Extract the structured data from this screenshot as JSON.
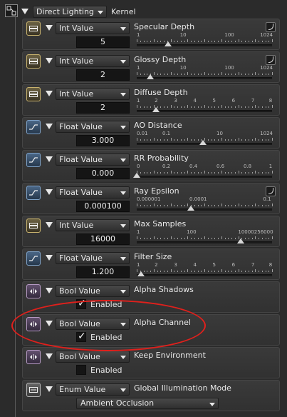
{
  "header": {
    "mode": "Direct Lighting",
    "kernel_label": "Kernel"
  },
  "params": [
    {
      "kind": "int",
      "vtype": "Int Value",
      "name": "Specular Depth",
      "value": "5",
      "curve": true,
      "ticks": [
        "1",
        "10",
        "100",
        "1024"
      ],
      "tick_pos": [
        0,
        0.33,
        0.66,
        1
      ],
      "thumb": 0.23
    },
    {
      "kind": "int",
      "vtype": "Int Value",
      "name": "Glossy Depth",
      "value": "2",
      "curve": true,
      "ticks": [
        "1",
        "10",
        "100",
        "1024"
      ],
      "tick_pos": [
        0,
        0.33,
        0.66,
        1
      ],
      "thumb": 0.1
    },
    {
      "kind": "int",
      "vtype": "Int Value",
      "name": "Diffuse Depth",
      "value": "2",
      "curve": false,
      "ticks": [
        "1",
        "2",
        "3",
        "4",
        "5",
        "6",
        "7",
        "8"
      ],
      "tick_pos": [
        0,
        0.143,
        0.286,
        0.429,
        0.571,
        0.714,
        0.857,
        1
      ],
      "thumb": 0.143
    },
    {
      "kind": "float",
      "vtype": "Float Value",
      "name": "AO Distance",
      "value": "3.000",
      "curve": false,
      "ticks": [
        "0.01",
        "0.1",
        "10",
        "1024"
      ],
      "tick_pos": [
        0,
        0.2,
        0.6,
        1
      ],
      "thumb": 0.49
    },
    {
      "kind": "float",
      "vtype": "Float Value",
      "name": "RR Probability",
      "value": "0.000",
      "curve": false,
      "ticks": [
        "0",
        "0.2",
        "0.4",
        "0.6",
        "0.8",
        "1"
      ],
      "tick_pos": [
        0,
        0.2,
        0.4,
        0.6,
        0.8,
        1
      ],
      "thumb": 0
    },
    {
      "kind": "float",
      "vtype": "Float Value",
      "name": "Ray Epsilon",
      "value": "0.000100",
      "curve": true,
      "ticks": [
        "0.000001",
        "0.0001",
        "0.1"
      ],
      "tick_pos": [
        0,
        0.4,
        1
      ],
      "thumb": 0.4
    },
    {
      "kind": "int",
      "vtype": "Int Value",
      "name": "Max Samples",
      "value": "16000",
      "curve": false,
      "ticks": [
        "1",
        "100",
        "10000",
        "256000"
      ],
      "tick_pos": [
        0,
        0.38,
        0.76,
        1
      ],
      "thumb": 0.77
    },
    {
      "kind": "float",
      "vtype": "Float Value",
      "name": "Filter Size",
      "value": "1.200",
      "curve": false,
      "ticks": [
        "1",
        "2",
        "3",
        "4",
        "5",
        "6",
        "7",
        "8"
      ],
      "tick_pos": [
        0,
        0.143,
        0.286,
        0.429,
        0.571,
        0.714,
        0.857,
        1
      ],
      "thumb": 0.03
    },
    {
      "kind": "bool",
      "vtype": "Bool Value",
      "name": "Alpha Shadows",
      "checked": true,
      "check_label": "Enabled"
    },
    {
      "kind": "bool",
      "vtype": "Bool Value",
      "name": "Alpha Channel",
      "checked": true,
      "check_label": "Enabled"
    },
    {
      "kind": "bool",
      "vtype": "Bool Value",
      "name": "Keep Environment",
      "checked": false,
      "check_label": "Enabled"
    },
    {
      "kind": "enum",
      "vtype": "Enum Value",
      "name": "Global Illumination Mode",
      "enum_value": "Ambient Occlusion"
    }
  ],
  "colors": {
    "highlight_ellipse": "#e0201c",
    "int_accent": "#c9b36e",
    "float_accent": "#7fa3c9",
    "bool_accent": "#b69ac4"
  }
}
